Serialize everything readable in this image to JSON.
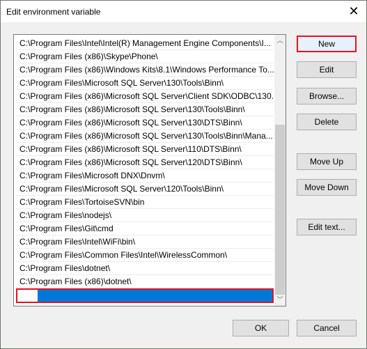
{
  "window": {
    "title": "Edit environment variable",
    "close_icon": "close-icon"
  },
  "paths": [
    "C:\\Program Files\\Intel\\Intel(R) Management Engine Components\\I...",
    "C:\\Program Files (x86)\\Skype\\Phone\\",
    "C:\\Program Files (x86)\\Windows Kits\\8.1\\Windows Performance To...",
    "C:\\Program Files\\Microsoft SQL Server\\130\\Tools\\Binn\\",
    "C:\\Program Files (x86)\\Microsoft SQL Server\\Client SDK\\ODBC\\130...",
    "C:\\Program Files (x86)\\Microsoft SQL Server\\130\\Tools\\Binn\\",
    "C:\\Program Files (x86)\\Microsoft SQL Server\\130\\DTS\\Binn\\",
    "C:\\Program Files (x86)\\Microsoft SQL Server\\130\\Tools\\Binn\\Mana...",
    "C:\\Program Files (x86)\\Microsoft SQL Server\\110\\DTS\\Binn\\",
    "C:\\Program Files (x86)\\Microsoft SQL Server\\120\\DTS\\Binn\\",
    "C:\\Program Files\\Microsoft DNX\\Dnvm\\",
    "C:\\Program Files\\Microsoft SQL Server\\120\\Tools\\Binn\\",
    "C:\\Program Files\\TortoiseSVN\\bin",
    "C:\\Program Files\\nodejs\\",
    "C:\\Program Files\\Git\\cmd",
    "C:\\Program Files\\Intel\\WiFi\\bin\\",
    "C:\\Program Files\\Common Files\\Intel\\WirelessCommon\\",
    "C:\\Program Files\\dotnet\\",
    "C:\\Program Files (x86)\\dotnet\\"
  ],
  "new_entry_value": "",
  "buttons": {
    "new": "New",
    "edit": "Edit",
    "browse": "Browse...",
    "delete": "Delete",
    "move_up": "Move Up",
    "move_down": "Move Down",
    "edit_text": "Edit text...",
    "ok": "OK",
    "cancel": "Cancel"
  },
  "colors": {
    "selection": "#0078d7",
    "focus_highlight": "#e81123"
  }
}
